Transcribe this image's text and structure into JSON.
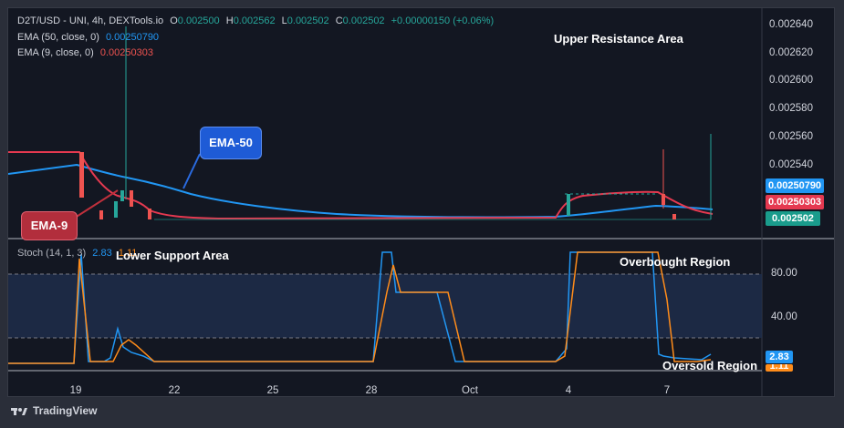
{
  "header": {
    "symbol": "D2T/USD - UNI, 4h, DEXTools.io",
    "o_label": "O",
    "o_value": "0.002500",
    "h_label": "H",
    "h_value": "0.002562",
    "l_label": "L",
    "l_value": "0.002502",
    "c_label": "C",
    "c_value": "0.002502",
    "change": "+0.00000150 (+0.06%)"
  },
  "indicators": {
    "ema50_label": "EMA (50, close, 0)",
    "ema50_value": "0.00250790",
    "ema9_label": "EMA (9, close, 0)",
    "ema9_value": "0.00250303",
    "stoch_label": "Stoch (14, 1, 3)",
    "stoch_k": "2.83",
    "stoch_d": "1.11"
  },
  "price_axis": [
    "0.002640",
    "0.002620",
    "0.002600",
    "0.002580",
    "0.002560",
    "0.002540"
  ],
  "price_tags": {
    "ema50": "0.00250790",
    "ema9": "0.00250303",
    "last": "0.002502"
  },
  "osc_axis": [
    "80.00",
    "40.00"
  ],
  "osc_tags": {
    "k": "2.83",
    "d": "1.11"
  },
  "dates": [
    "19",
    "22",
    "25",
    "28",
    "Oct",
    "4",
    "7"
  ],
  "annotations": {
    "upper": "Upper Resistance Area",
    "lower": "Lower Support Area",
    "overbought": "Overbought Region",
    "oversold": "Oversold Region",
    "ema50_callout": "EMA-50",
    "ema9_callout": "EMA-9"
  },
  "footer": {
    "brand": "TradingView"
  },
  "colors": {
    "up": "#26a69a",
    "down": "#ef5350",
    "ema50": "#2196f3",
    "ema9": "#e53950",
    "stoch_k": "#2196f3",
    "stoch_d": "#ff8c1a"
  }
}
